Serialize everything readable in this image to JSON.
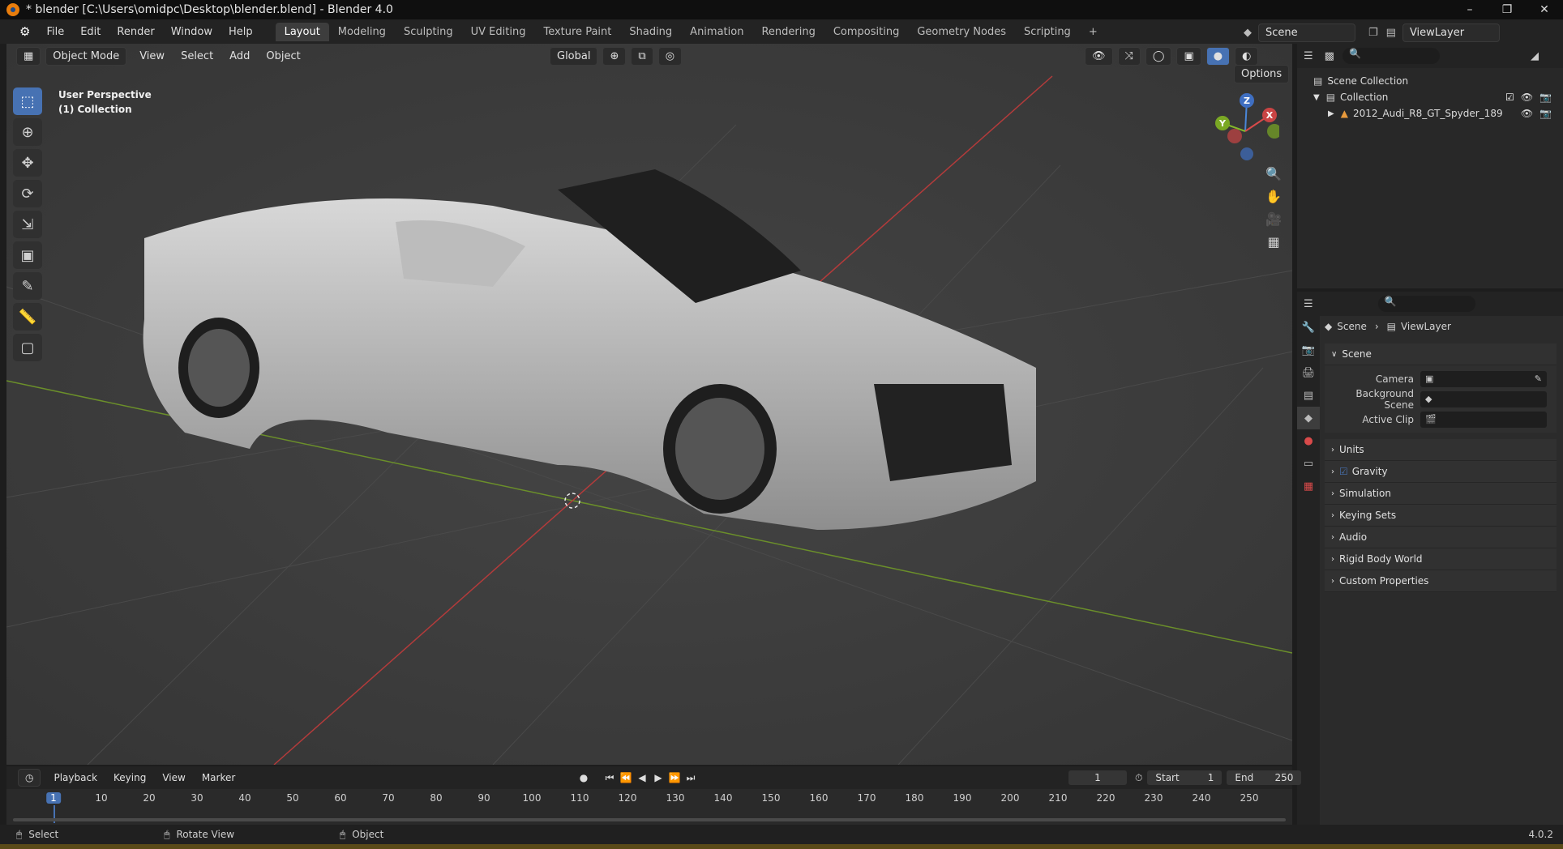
{
  "titlebar": {
    "title": "* blender [C:\\Users\\omidpc\\Desktop\\blender.blend] - Blender 4.0"
  },
  "menu": {
    "items": [
      "File",
      "Edit",
      "Render",
      "Window",
      "Help"
    ]
  },
  "workspaces": [
    "Layout",
    "Modeling",
    "Sculpting",
    "UV Editing",
    "Texture Paint",
    "Shading",
    "Animation",
    "Rendering",
    "Compositing",
    "Geometry Nodes",
    "Scripting"
  ],
  "topright": {
    "scene": "Scene",
    "viewlayer": "ViewLayer"
  },
  "viewport_header": {
    "mode": "Object Mode",
    "menus": [
      "View",
      "Select",
      "Add",
      "Object"
    ],
    "orientation": "Global",
    "options": "Options"
  },
  "viewport_info": {
    "perspective": "User Perspective",
    "collection": "(1) Collection"
  },
  "gizmo": {
    "x": "X",
    "y": "Y",
    "z": "Z"
  },
  "outliner": {
    "scene_collection": "Scene Collection",
    "collection": "Collection",
    "object": "2012_Audi_R8_GT_Spyder_189"
  },
  "properties": {
    "breadcrumb_scene": "Scene",
    "breadcrumb_viewlayer": "ViewLayer",
    "scene_section": "Scene",
    "rows": [
      {
        "label": "Camera"
      },
      {
        "label": "Background Scene"
      },
      {
        "label": "Active Clip"
      }
    ],
    "sections": [
      "Units",
      "Gravity",
      "Simulation",
      "Keying Sets",
      "Audio",
      "Rigid Body World",
      "Custom Properties"
    ]
  },
  "timeline": {
    "menus": [
      "Playback",
      "Keying",
      "View",
      "Marker"
    ],
    "current_frame": "1",
    "start_label": "Start",
    "start": "1",
    "end_label": "End",
    "end": "250",
    "ticks": [
      "1",
      "10",
      "20",
      "30",
      "40",
      "50",
      "60",
      "70",
      "80",
      "90",
      "100",
      "110",
      "120",
      "130",
      "140",
      "150",
      "160",
      "170",
      "180",
      "190",
      "200",
      "210",
      "220",
      "230",
      "240",
      "250"
    ]
  },
  "statusbar": {
    "select": "Select",
    "rotate": "Rotate View",
    "object": "Object",
    "version": "4.0.2"
  }
}
